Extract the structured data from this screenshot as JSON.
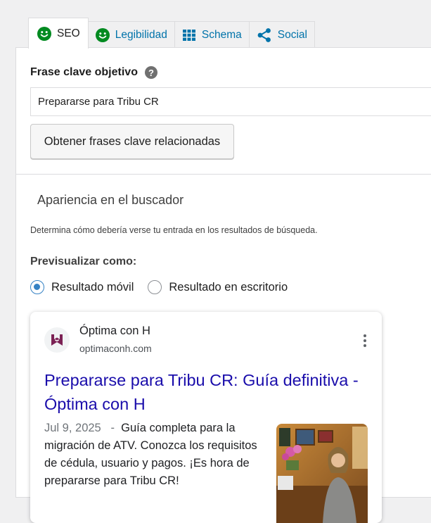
{
  "tabs": [
    {
      "label": "SEO",
      "icon": "smiley-icon",
      "active": true
    },
    {
      "label": "Legibilidad",
      "icon": "smiley-icon",
      "active": false
    },
    {
      "label": "Schema",
      "icon": "grid-icon",
      "active": false
    },
    {
      "label": "Social",
      "icon": "share-icon",
      "active": false
    }
  ],
  "colors": {
    "accent": "#0073aa",
    "good": "#008a20",
    "radio": "#3582c4",
    "serp_link": "#1a0dab"
  },
  "focus_keyphrase": {
    "label": "Frase clave objetivo",
    "help": "?",
    "value": "Prepararse para Tribu CR",
    "related_button": "Obtener frases clave relacionadas"
  },
  "search_appearance": {
    "title": "Apariencia en el buscador",
    "description": "Determina cómo debería verse tu entrada en los resultados de búsqueda.",
    "preview_label": "Previsualizar como:",
    "options": [
      {
        "label": "Resultado móvil",
        "checked": true
      },
      {
        "label": "Resultado en escritorio",
        "checked": false
      }
    ]
  },
  "serp": {
    "site_name": "Óptima con H",
    "site_url": "optimaconh.com",
    "title": "Prepararse para Tribu CR: Guía definitiva - Óptima con H",
    "date": "Jul 9, 2025",
    "separator": "-",
    "snippet": "Guía completa para la migración de ATV. Conozca los requisitos de cédula, usuario y pagos. ¡Es hora de prepararse para Tribu CR!"
  }
}
